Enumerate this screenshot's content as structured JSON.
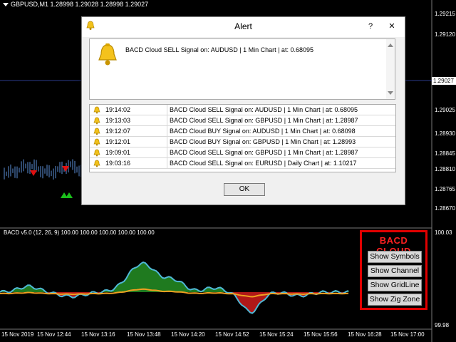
{
  "chart": {
    "symbol_label": "GBPUSD,M1  1.28998 1.29028 1.28998 1.29027",
    "current_price": "1.29027",
    "price_labels": [
      "1.29215",
      "1.29120",
      "1.29025",
      "1.28930",
      "1.28845",
      "1.28810",
      "1.28765",
      "1.28670"
    ],
    "indicator_title": "BACD v5.0 (12, 26, 9) 100.00 100.00 100.00 100.00 100.00",
    "indicator_scale_top": "100.03",
    "indicator_scale_bottom": "99.98",
    "time_labels": [
      "15 Nov 2019",
      "15 Nov 12:44",
      "15 Nov 13:16",
      "15 Nov 13:48",
      "15 Nov 14:20",
      "15 Nov 14:52",
      "15 Nov 15:24",
      "15 Nov 15:56",
      "15 Nov 16:28",
      "15 Nov 17:00"
    ],
    "colors": {
      "green_fill": "#1f7a1f",
      "red_fill": "#b01818",
      "cyan_line": "#4fb8d6",
      "orange_line": "#f0a020",
      "candle": "#5d8fd8"
    }
  },
  "bacd_panel": {
    "title": "BACD CLOUD",
    "buttons": [
      "Show Symbols",
      "Show Channel",
      "Show GridLine",
      "Show Zig Zone"
    ]
  },
  "alert": {
    "title": "Alert",
    "message": "BACD Cloud SELL Signal on: AUDUSD | 1 Min Chart |  at: 0.68095",
    "rows": [
      {
        "time": "19:14:02",
        "text": "BACD Cloud SELL Signal on: AUDUSD | 1 Min Chart |  at: 0.68095"
      },
      {
        "time": "19:13:03",
        "text": "BACD Cloud SELL Signal on: GBPUSD | 1 Min Chart |  at: 1.28987"
      },
      {
        "time": "19:12:07",
        "text": "BACD Cloud BUY  Signal on: AUDUSD | 1 Min Chart |  at: 0.68098"
      },
      {
        "time": "19:12:01",
        "text": "BACD Cloud BUY  Signal on: GBPUSD | 1 Min Chart |  at: 1.28993"
      },
      {
        "time": "19:09:01",
        "text": "BACD Cloud SELL Signal on: GBPUSD | 1 Min Chart |  at: 1.28987"
      },
      {
        "time": "19:03:16",
        "text": "BACD Cloud SELL Signal on: EURUSD | Daily Chart |  at: 1.10217"
      }
    ],
    "ok_label": "OK",
    "help_label": "?",
    "close_label": "✕"
  }
}
